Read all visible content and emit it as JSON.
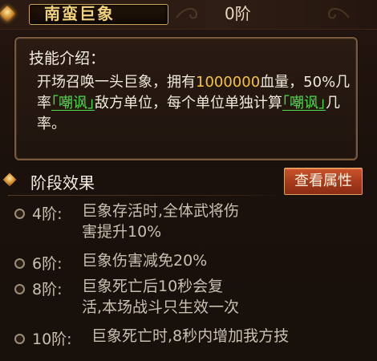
{
  "header": {
    "name": "南蛮巨象",
    "level": "0阶"
  },
  "skill": {
    "title": "技能介绍：",
    "text_part1": "开场召唤一头巨象，拥有",
    "hp_value": "1000000",
    "text_part2": "血量，50%几率",
    "tag1": "｢嘲讽｣",
    "text_part3": "敌方单位，每个单位单独计算",
    "tag2": "｢嘲讽｣",
    "text_part4": "几率。"
  },
  "stages": {
    "title": "阶段效果",
    "attr_button": "查看属性",
    "items": [
      {
        "level": "4阶:",
        "desc": "巨象存活时,全体武将伤害提升10%"
      },
      {
        "level": "6阶:",
        "desc": "巨象伤害减免20%"
      },
      {
        "level": "8阶:",
        "desc": "巨象死亡后10秒会复活,本场战斗只生效一次"
      },
      {
        "level": "10阶:",
        "desc": "巨象死亡时,8秒内增加我方技"
      }
    ]
  },
  "colors": {
    "highlight": "#f5c43c",
    "tag": "#49e04a",
    "button": "#b8461f",
    "title_gold": "#f2d27a"
  }
}
